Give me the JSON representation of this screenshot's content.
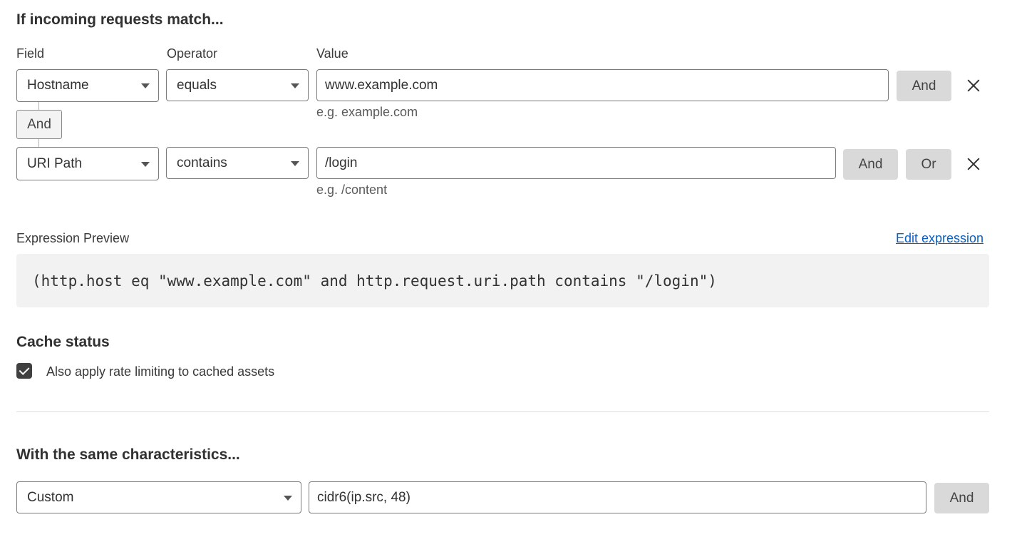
{
  "match_section": {
    "title": "If incoming requests match...",
    "columns": {
      "field": "Field",
      "operator": "Operator",
      "value": "Value"
    },
    "rows": [
      {
        "field": "Hostname",
        "operator": "equals",
        "value": "www.example.com",
        "hint": "e.g. example.com",
        "and_label": "And"
      },
      {
        "field": "URI Path",
        "operator": "contains",
        "value": "/login",
        "hint": "e.g. /content",
        "and_label": "And",
        "or_label": "Or"
      }
    ],
    "connector_label": "And"
  },
  "expression": {
    "label": "Expression Preview",
    "edit_link": "Edit expression",
    "text": "(http.host eq \"www.example.com\" and http.request.uri.path contains \"/login\")"
  },
  "cache_status": {
    "title": "Cache status",
    "checkbox_label": "Also apply rate limiting to cached assets",
    "checked": true
  },
  "characteristics": {
    "title": "With the same characteristics...",
    "select_value": "Custom",
    "input_value": "cidr6(ip.src, 48)",
    "and_label": "And"
  }
}
